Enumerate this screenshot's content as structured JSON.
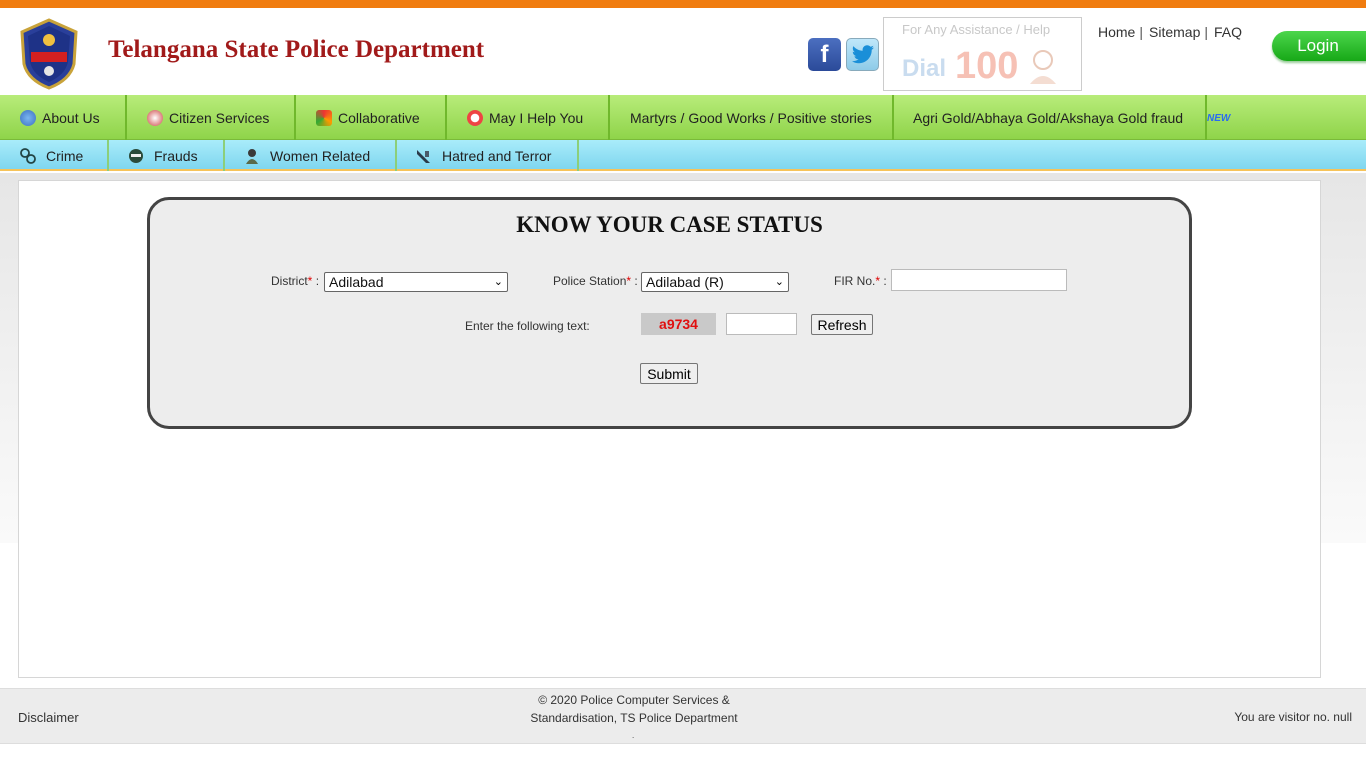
{
  "header": {
    "title": "Telangana State Police Department",
    "logo_text": "TELANGANA STATE POLICE",
    "dial": {
      "help": "For Any Assistance / Help",
      "word": "Dial",
      "number": "100"
    },
    "links": [
      "Home",
      "Sitemap",
      "FAQ"
    ],
    "login_label": "Login"
  },
  "nav_primary": {
    "items": [
      {
        "label": "About Us",
        "icon": "info-icon"
      },
      {
        "label": "Citizen Services",
        "icon": "services-icon"
      },
      {
        "label": "Collaborative",
        "icon": "collaborative-icon"
      },
      {
        "label": "May I Help You",
        "icon": "lifebuoy-icon"
      },
      {
        "label": "Martyrs / Good Works / Positive stories",
        "icon": ""
      },
      {
        "label": "Agri Gold/Abhaya Gold/Akshaya Gold fraud",
        "icon": ""
      }
    ],
    "new_badge": "NEW"
  },
  "nav_secondary": {
    "items": [
      {
        "label": "Crime",
        "icon": "handcuffs-icon"
      },
      {
        "label": "Frauds",
        "icon": "masked-person-icon"
      },
      {
        "label": "Women Related",
        "icon": "woman-icon"
      },
      {
        "label": "Hatred and Terror",
        "icon": "terror-icon"
      }
    ]
  },
  "form": {
    "title": "KNOW YOUR CASE STATUS",
    "district_label": "District",
    "district_value": "Adilabad",
    "station_label": "Police Station",
    "station_value": "Adilabad (R)",
    "fir_label": "FIR No.",
    "required_mark": "*",
    "colon": ":",
    "captcha_label": "Enter the following text:",
    "captcha_text": "a9734",
    "refresh_label": "Refresh",
    "submit_label": "Submit"
  },
  "footer": {
    "disclaimer": "Disclaimer",
    "copyright_line1": "© 2020 Police Computer Services &",
    "copyright_line2": "Standardisation, TS Police Department",
    "dot": ".",
    "visitor": "You are visitor no. null"
  },
  "colors": {
    "top_stripe": "#f07c0f",
    "title_red": "#a11a1a",
    "nav_green": "#9ddd58",
    "nav_blue": "#8fdcf2",
    "login_green": "#1fb01f",
    "captcha_red": "#e01010"
  }
}
